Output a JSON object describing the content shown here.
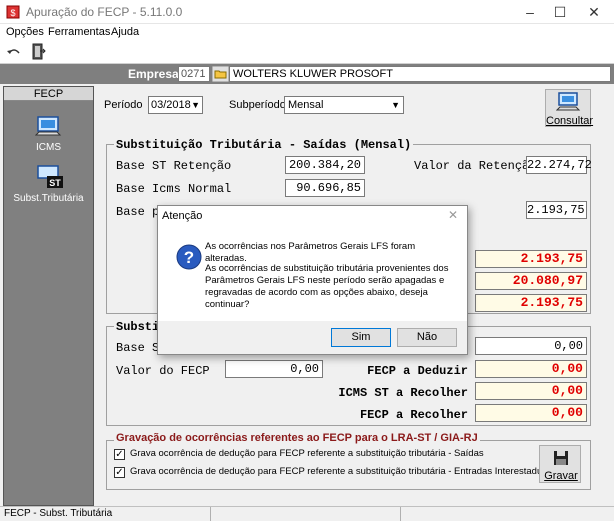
{
  "window": {
    "title": "Apuração do FECP - 5.11.0.0"
  },
  "menu": {
    "items": [
      "Opções",
      "Ferramentas",
      "Ajuda"
    ]
  },
  "empresa": {
    "label": "Empresa",
    "code": "0271",
    "name": "WOLTERS KLUWER PROSOFT"
  },
  "sidebar": {
    "header": "FECP",
    "items": [
      {
        "label": "ICMS",
        "icon": "computer-icon"
      },
      {
        "label": "Subst.Tributária",
        "icon": "st-icon"
      }
    ]
  },
  "filters": {
    "periodo_label": "Período",
    "periodo_value": "03/2018",
    "subperiodo_label": "Subperíodo",
    "subperiodo_value": "Mensal"
  },
  "consultar_label": "Consultar",
  "group1": {
    "title": "Substituição Tributária - Saídas (Mensal)",
    "base_st_retencao_label": "Base ST Retenção",
    "base_st_retencao_value": "200.384,20",
    "valor_retencao_label": "Valor da Retenção",
    "valor_retencao_value": "22.274,72",
    "base_icms_normal_label": "Base Icms Normal",
    "base_icms_normal_value": "90.696,85",
    "base_p_label": "Base p/",
    "right_value_1": "2.193,75",
    "yellow_1": "2.193,75",
    "yellow_2": "20.080,97",
    "yellow_3": "2.193,75"
  },
  "group2": {
    "title_fragment": "Substi",
    "base_label_fragment": "Base S",
    "top_right_value": "0,00",
    "valor_fecp_label": "Valor do FECP",
    "valor_fecp_value": "0,00",
    "fecp_deduzir_label": "FECP a Deduzir",
    "fecp_deduzir_value": "0,00",
    "icms_st_recolher_label": "ICMS ST a Recolher",
    "icms_st_recolher_value": "0,00",
    "fecp_recolher_label": "FECP a Recolher",
    "fecp_recolher_value": "0,00"
  },
  "group3": {
    "title": "Gravação de ocorrências referentes ao FECP  para o LRA-ST / GIA-RJ",
    "check1": "Grava ocorrência de dedução para FECP referente a substituição tributária - Saídas",
    "check2": "Grava ocorrência de dedução para FECP referente a substituição tributária - Entradas Interestaduais",
    "gravar_label": "Gravar"
  },
  "dialog": {
    "title": "Atenção",
    "line1": "As ocorrências nos Parâmetros Gerais LFS foram alteradas.",
    "line2": "As ocorrências de substituição tributária provenientes dos Parâmetros Gerais LFS neste período serão apagadas e regravadas de acordo com as opções abaixo, deseja continuar?",
    "yes_label": "Sim",
    "no_label": "Não",
    "icon": "question-icon"
  },
  "status": {
    "text": "FECP - Subst. Tributária"
  },
  "colors": {
    "accent_red": "#e00000",
    "yellow_bg": "#fffbe6",
    "sidebar_bg": "#808080"
  }
}
